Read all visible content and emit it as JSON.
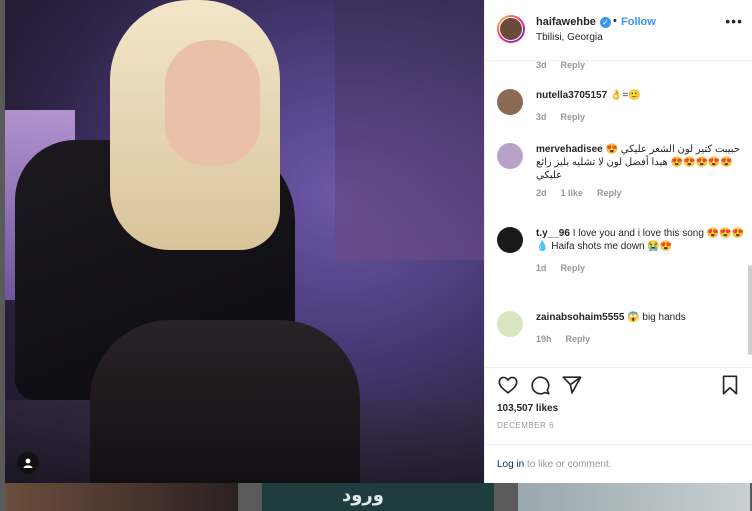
{
  "post": {
    "author": "haifawehbe",
    "follow_label": "Follow",
    "separator": "•",
    "location": "Tbilisi, Georgia",
    "more_label": "•••",
    "likes": "103,507 likes",
    "date": "DECEMBER 6",
    "login_link": "Log in",
    "login_suffix": " to like or comment."
  },
  "comments": [
    {
      "user": "",
      "text": "",
      "time": "3d",
      "likes": "",
      "reply": "Reply",
      "avatar_color": "#ffffff"
    },
    {
      "user": "nutella3705157",
      "text": "👌=🙂",
      "time": "3d",
      "likes": "",
      "reply": "Reply",
      "avatar_color": "#8a6a55"
    },
    {
      "user": "mervehadisee",
      "text": "حبيبت كتير لون الشعر عليكي 😍😍😍😍😍😍 هيدا أفضل لون لا تشليه بليز رائع عليكي",
      "time": "2d",
      "likes": "1 like",
      "reply": "Reply",
      "avatar_color": "#b9a2c8"
    },
    {
      "user": "t.y__96",
      "text": "I love you and i love this song 😍😍😍💧 Haifa shots me down 😭😍",
      "time": "1d",
      "likes": "",
      "reply": "Reply",
      "avatar_color": "#1a1a1a"
    },
    {
      "user": "zainabsohaim5555",
      "text": "😱 big hands",
      "time": "19h",
      "likes": "",
      "reply": "Reply",
      "avatar_color": "#d7e6c0"
    }
  ],
  "thumbs": {
    "middle_text": "ورود"
  },
  "colors": {
    "link": "#3897f0",
    "text": "#262626",
    "muted": "#999999"
  }
}
